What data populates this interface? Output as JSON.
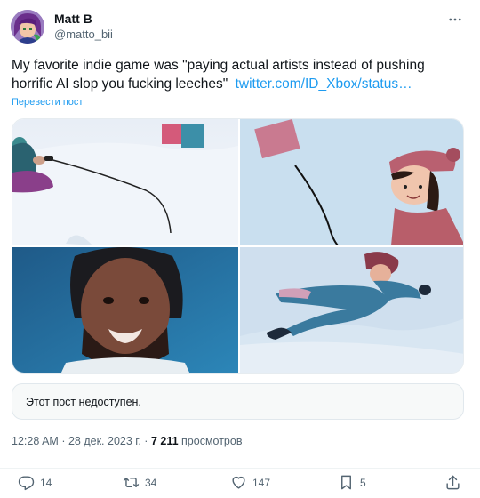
{
  "author": {
    "name": "Matt B",
    "handle": "@matto_bii"
  },
  "tweet": {
    "text": "My favorite indie game was \"paying actual artists instead of pushing horrific AI slop you fucking leeches\"",
    "link": "twitter.com/ID_Xbox/status…",
    "translate_label": "Перевести пост"
  },
  "media": {
    "images": [
      "snow-scene-telephone",
      "girl-in-snow-hat",
      "smiling-bearded-man",
      "person-falling-in-snow"
    ]
  },
  "quoted": {
    "unavailable_text": "Этот пост недоступен."
  },
  "meta": {
    "time": "12:28 AM",
    "date": "28 дек. 2023 г.",
    "separator1": "·",
    "separator2": "·",
    "views_count": "7 211",
    "views_label": "просмотров"
  },
  "actions": {
    "replies": "14",
    "reposts": "34",
    "likes": "147",
    "bookmarks": "5"
  },
  "colors": {
    "accent": "#1d9bf0",
    "text": "#0f1419",
    "secondary": "#536471"
  },
  "icons": [
    "more-icon",
    "reply-icon",
    "repost-icon",
    "like-icon",
    "bookmark-icon",
    "share-icon"
  ]
}
